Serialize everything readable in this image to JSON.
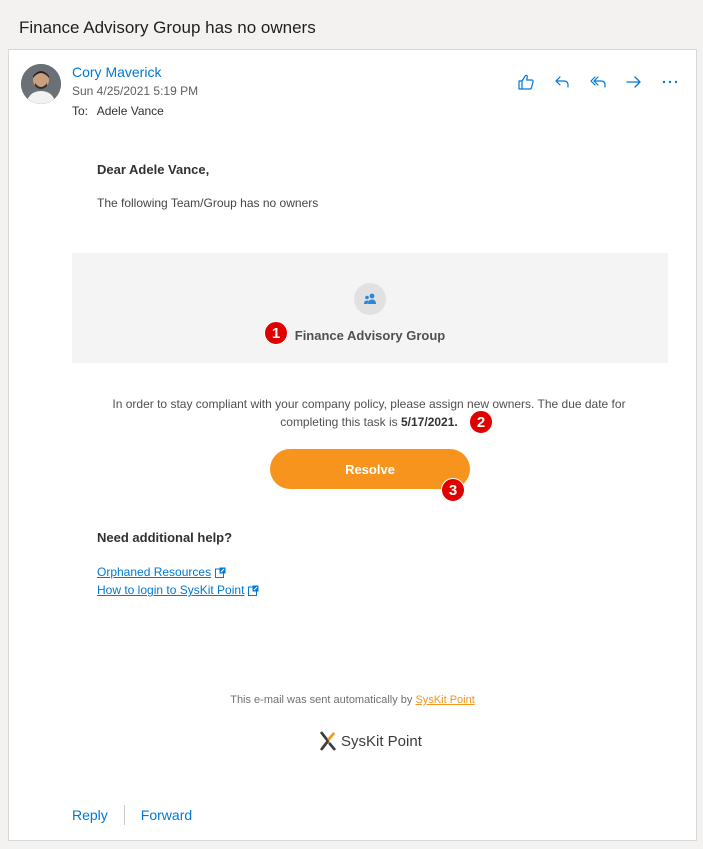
{
  "subject": "Finance Advisory Group has no owners",
  "sender": {
    "name": "Cory Maverick",
    "date": "Sun 4/25/2021 5:19 PM",
    "to_label": "To:",
    "to_name": "Adele Vance"
  },
  "actions": [
    {
      "icon": "like-icon"
    },
    {
      "icon": "reply-icon"
    },
    {
      "icon": "reply-all-icon"
    },
    {
      "icon": "forward-icon"
    },
    {
      "icon": "more-icon"
    }
  ],
  "body": {
    "greeting": "Dear Adele Vance,",
    "intro": "The following Team/Group has no owners",
    "group_name": "Finance Advisory Group",
    "policy_text": "In order to stay compliant with your company policy, please assign new owners. The due date for completing this task is",
    "due_date": "5/17/2021.",
    "resolve_label": "Resolve",
    "help_title": "Need additional help?",
    "links": [
      "Orphaned Resources",
      "How to login to SysKit Point"
    ],
    "footer_text": "This e-mail was sent automatically by",
    "footer_link": "SysKit Point",
    "logo_text": "SysKit Point"
  },
  "badges": [
    "1",
    "2",
    "3"
  ],
  "reply_bar": {
    "reply_label": "Reply",
    "forward_label": "Forward"
  },
  "colors": {
    "accent": "#0078d4",
    "resolve": "#f7941d",
    "badge": "#e00000"
  }
}
